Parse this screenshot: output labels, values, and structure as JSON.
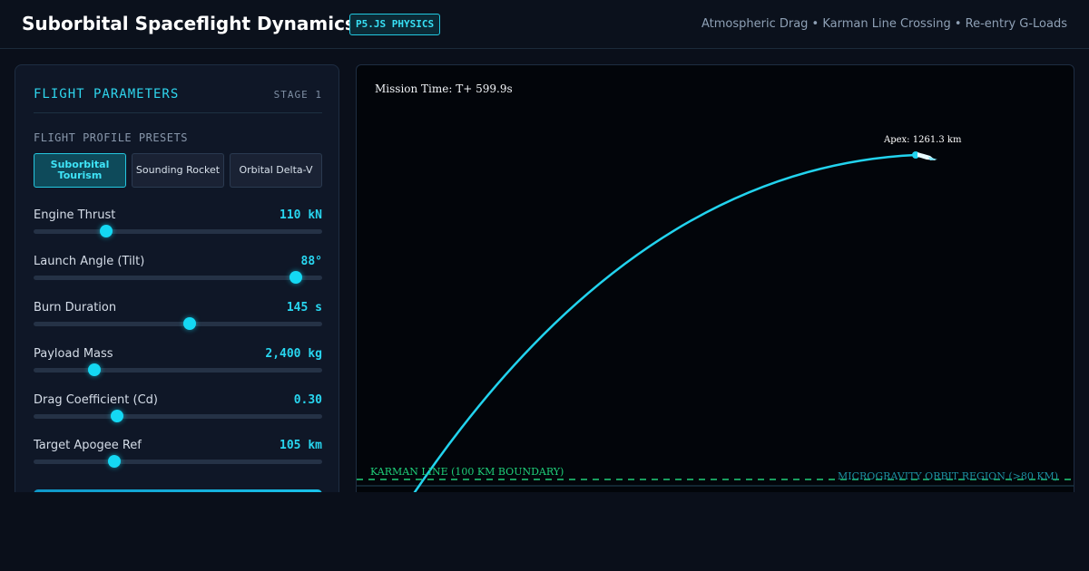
{
  "header": {
    "title": "Suborbital Spaceflight Dynamics",
    "badge": "P5.JS PHYSICS",
    "subtitle": "Atmospheric Drag • Karman Line Crossing • Re-entry G-Loads"
  },
  "panel": {
    "title": "FLIGHT PARAMETERS",
    "stage": "STAGE 1",
    "presets_label": "FLIGHT PROFILE PRESETS",
    "presets": [
      {
        "label": "Suborbital Tourism",
        "active": true
      },
      {
        "label": "Sounding Rocket",
        "active": false
      },
      {
        "label": "Orbital Delta-V",
        "active": false
      }
    ],
    "params": [
      {
        "label": "Engine Thrust",
        "value": "110 kN",
        "level": 0.25
      },
      {
        "label": "Launch Angle (Tilt)",
        "value": "88°",
        "level": 0.91
      },
      {
        "label": "Burn Duration",
        "value": "145 s",
        "level": 0.54
      },
      {
        "label": "Payload Mass",
        "value": "2,400 kg",
        "level": 0.21
      },
      {
        "label": "Drag Coefficient (Cd)",
        "value": "0.30",
        "level": 0.29
      },
      {
        "label": "Target Apogee Ref",
        "value": "105 km",
        "level": 0.28
      }
    ]
  },
  "viz": {
    "mission_time": "Mission Time: T+ 599.9s",
    "apex_label": "Apex: 1261.3 km",
    "karman_label": "KARMAN LINE (100 KM BOUNDARY)",
    "microgravity_label": "MICROGRAVITY ORBIT REGION (>80 KM)"
  },
  "colors": {
    "accent": "#14d8f3",
    "trajectory": "#22d3ee",
    "karman": "#1fcf7a",
    "background": "#0a0f1a"
  }
}
